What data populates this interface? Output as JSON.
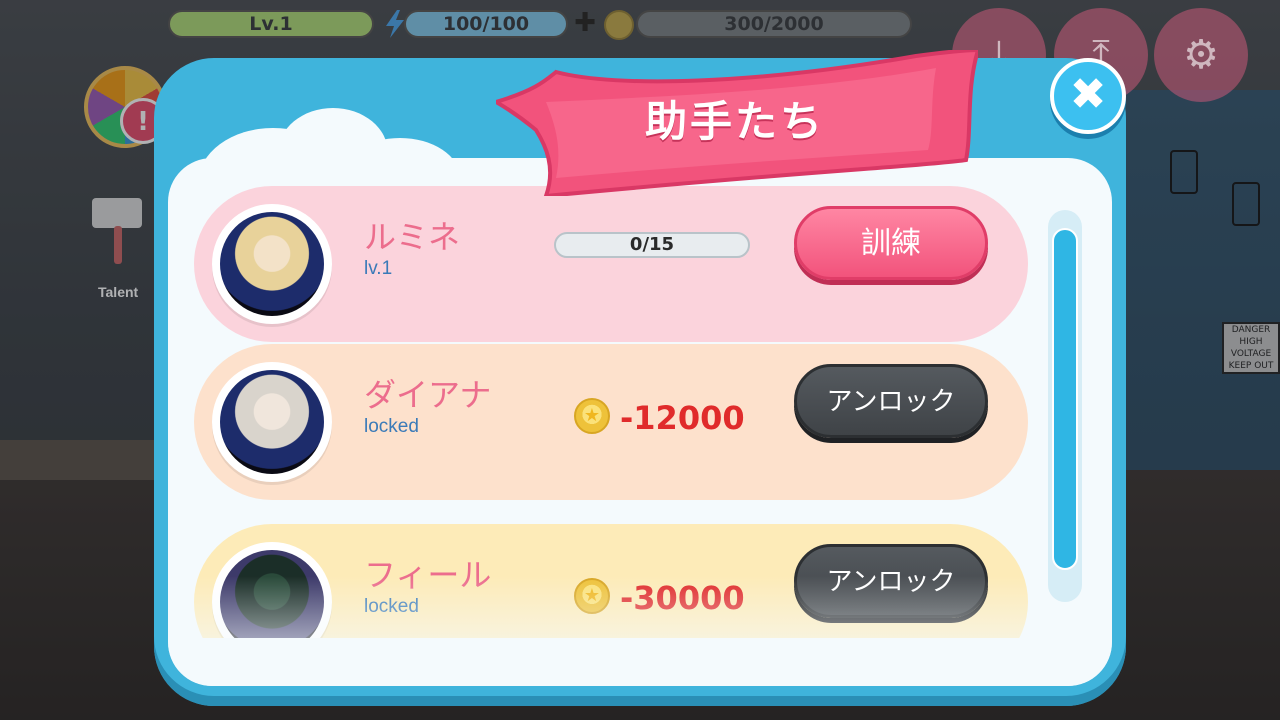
{
  "hud": {
    "level": "Lv.1",
    "energy": "100/100",
    "coins": "300/2000",
    "energy_icon": "lightning-icon",
    "plus_icon": "plus-icon",
    "coin_icon": "coin-icon",
    "buttons": [
      "download-icon",
      "upload-icon",
      "gear-icon"
    ]
  },
  "background": {
    "talent_label": "Talent"
  },
  "dialog": {
    "title": "助手たち",
    "close_icon": "close-icon",
    "assistants": [
      {
        "name": "ルミネ",
        "status": "lv.1",
        "progress": "0/15",
        "button_label": "訓練"
      },
      {
        "name": "ダイアナ",
        "status": "locked",
        "cost": "-12000",
        "button_label": "アンロック"
      },
      {
        "name": "フィール",
        "status": "locked",
        "cost": "-30000",
        "button_label": "アンロック"
      }
    ]
  },
  "colors": {
    "panel": "#3fb4dc",
    "ribbon": "#f2537c",
    "train_button": "#f2537c",
    "unlock_button": "#3f4347",
    "cost_text": "#e02b2b"
  }
}
